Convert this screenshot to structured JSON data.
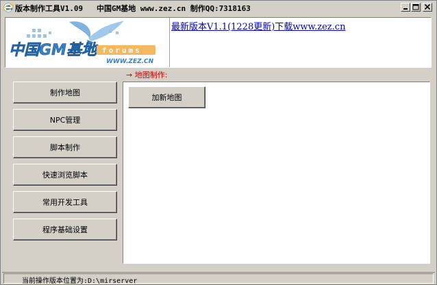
{
  "titlebar": {
    "title": "版本制作工具V1.09   中国GM基地 www.zez.cn 制作QQ:7318163",
    "icon": "ie-e-icon"
  },
  "banner": {
    "logo_text": "中国GM基地",
    "logo_badge": "forums",
    "logo_url": "WWW.ZEZ.CN",
    "news_link": "最新版本V1.1(1228更新)下载www.zez.cn"
  },
  "section_label": "→ 地图制作:",
  "nav": [
    {
      "label": "制作地图"
    },
    {
      "label": "NPC管理"
    },
    {
      "label": "脚本制作"
    },
    {
      "label": "快速浏览脚本"
    },
    {
      "label": "常用开发工具"
    },
    {
      "label": "程序基础设置"
    }
  ],
  "panel": {
    "add_map_label": "加新地图"
  },
  "status": {
    "text": "当前操作版本位置为:D:\\mirserver"
  },
  "colors": {
    "face": "#d4d0c8",
    "link": "#0000c0",
    "label_red": "#cc0000",
    "logo_blue": "#3a7fc0"
  }
}
